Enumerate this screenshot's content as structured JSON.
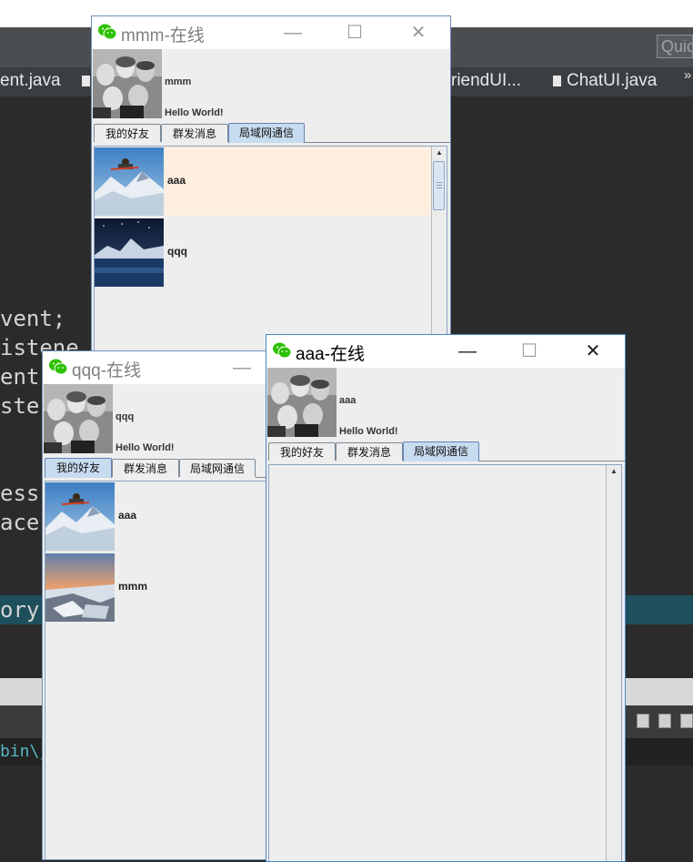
{
  "ide": {
    "quick_access": "Quick",
    "tabs": [
      "ent.java",
      "riendUI...",
      "ChatUI.java"
    ],
    "more_tabs": "»",
    "code_fragments": [
      "vent;",
      "istene",
      "ent",
      "ste",
      "ess",
      "ace",
      "ory"
    ],
    "console_path": "bin\\jav"
  },
  "windows": [
    {
      "title": "mmm-在线",
      "user": "mmm",
      "signature": "Hello World!",
      "tabs": [
        "我的好友",
        "群发消息",
        "局域网通信"
      ],
      "friends": [
        {
          "name": "aaa",
          "thumb": "ski-jump"
        },
        {
          "name": "qqq",
          "thumb": "night-lake"
        }
      ]
    },
    {
      "title": "qqq-在线",
      "user": "qqq",
      "signature": "Hello World!",
      "tabs": [
        "我的好友",
        "群发消息",
        "局域网通信"
      ],
      "friends": [
        {
          "name": "aaa",
          "thumb": "ski-jump"
        },
        {
          "name": "mmm",
          "thumb": "sunset-glacier"
        }
      ]
    },
    {
      "title": "aaa-在线",
      "user": "aaa",
      "signature": "Hello World!",
      "tabs": [
        "我的好友",
        "群发消息",
        "局域网通信"
      ],
      "friends": []
    }
  ],
  "window_controls": {
    "minimize": "—",
    "maximize": "☐",
    "close": "✕"
  },
  "colors": {
    "selected_tab": "#c8dcf0",
    "selected_row": "#fdeee0",
    "wechat_green": "#2dc100"
  }
}
